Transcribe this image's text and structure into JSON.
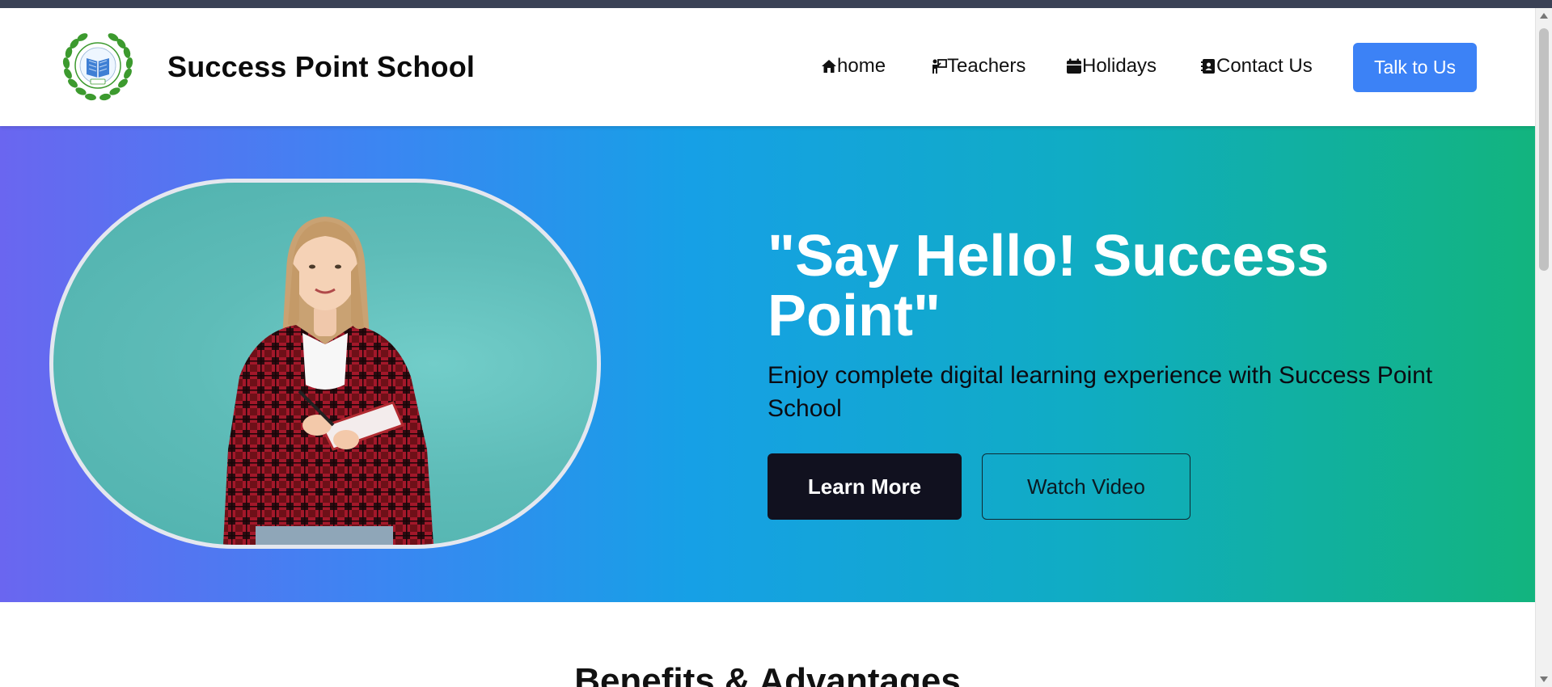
{
  "header": {
    "brand": "Success Point School",
    "nav": [
      {
        "label": "home",
        "icon": "home-icon"
      },
      {
        "label": "Teachers",
        "icon": "teacher-icon"
      },
      {
        "label": "Holidays",
        "icon": "calendar-icon"
      },
      {
        "label": "Contact Us",
        "icon": "contact-book-icon"
      }
    ],
    "cta_label": "Talk to Us"
  },
  "hero": {
    "title": "\"Say Hello! Success Point\"",
    "subtitle": "Enjoy complete digital learning experience with Success Point School",
    "primary_button": "Learn More",
    "secondary_button": "Watch Video"
  },
  "next_section": {
    "title": "Benefits & Advantages"
  },
  "colors": {
    "accent": "#3c82f6",
    "gradient_start": "#6a66f0",
    "gradient_mid": "#16a0e6",
    "gradient_end": "#12b47e",
    "dark_button": "#11111f"
  }
}
